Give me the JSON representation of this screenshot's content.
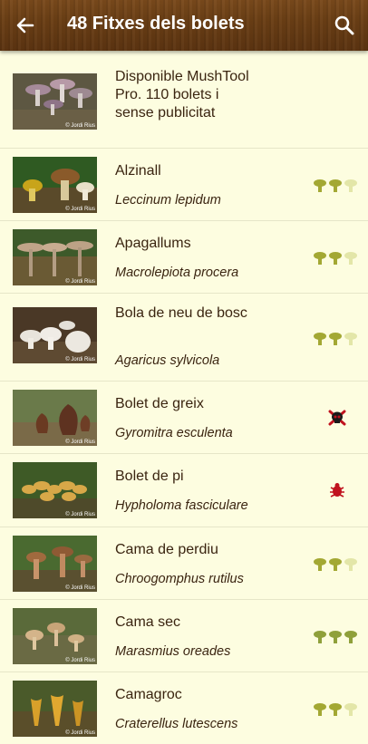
{
  "appbar": {
    "title": "48 Fitxes dels bolets",
    "back_icon": "arrow-left-icon",
    "search_icon": "search-icon"
  },
  "promo": {
    "text": "Disponible MushTool Pro. 110 bolets i sense publicitat",
    "credit": "© Jordi Rius"
  },
  "items": [
    {
      "name": "Alzinall",
      "latin": "Leccinum lepidum",
      "edibility": 2,
      "toxic": false
    },
    {
      "name": "Apagallums",
      "latin": "Macrolepiota procera",
      "edibility": 2,
      "toxic": false
    },
    {
      "name": "Bola de neu de bosc",
      "latin": "Agaricus sylvicola",
      "edibility": 2,
      "toxic": false
    },
    {
      "name": "Bolet de greix",
      "latin": "Gyromitra esculenta",
      "edibility": 0,
      "toxic": true,
      "toxic_kind": "deadly"
    },
    {
      "name": "Bolet de pi",
      "latin": "Hypholoma fasciculare",
      "edibility": 0,
      "toxic": true,
      "toxic_kind": "toxic"
    },
    {
      "name": "Cama de perdiu",
      "latin": "Chroogomphus rutilus",
      "edibility": 2,
      "toxic": false
    },
    {
      "name": "Cama sec",
      "latin": "Marasmius oreades",
      "edibility": 3,
      "toxic": false
    },
    {
      "name": "Camagroc",
      "latin": "Craterellus lutescens",
      "edibility": 2,
      "toxic": false
    }
  ],
  "credit": "© Jordi Rius",
  "colors": {
    "appbar": "#6b3f15",
    "background": "#fdfde0",
    "rating_on": "#a3a833",
    "rating_off": "#e3e6a8",
    "toxic": "#c0121e"
  }
}
